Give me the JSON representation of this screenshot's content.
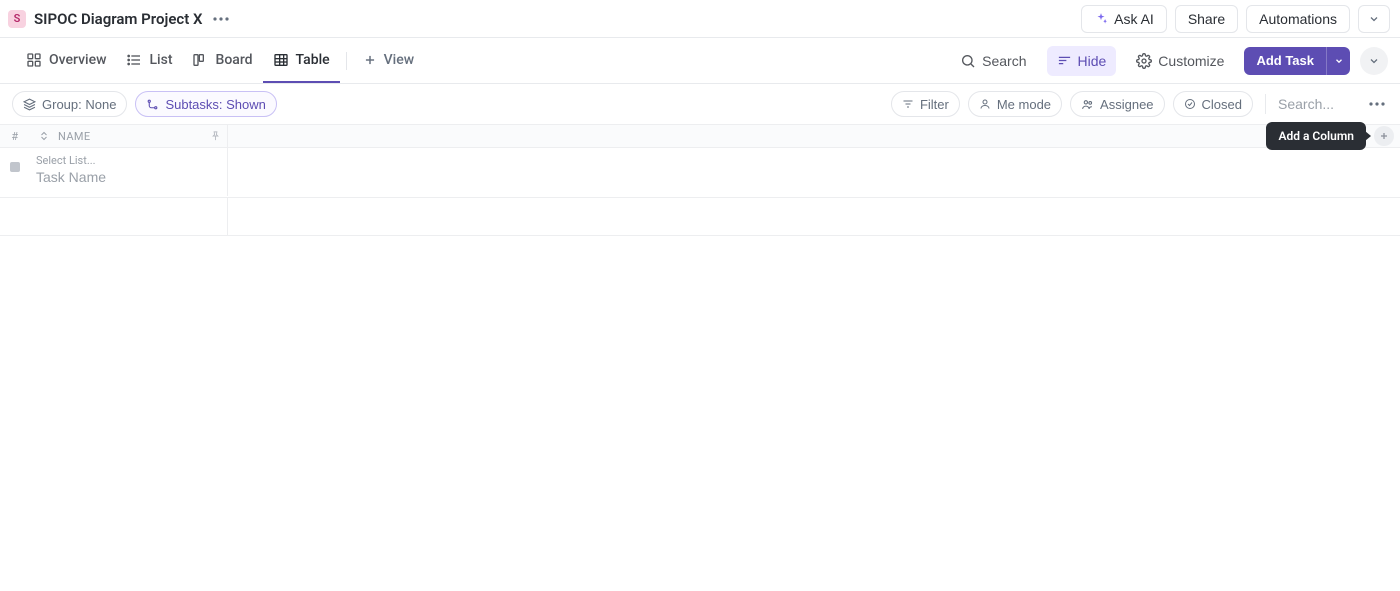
{
  "workspace": {
    "icon_letter": "S",
    "title": "SIPOC Diagram Project X"
  },
  "header_actions": {
    "ask_ai": "Ask AI",
    "share": "Share",
    "automations": "Automations"
  },
  "views": {
    "overview": "Overview",
    "list": "List",
    "board": "Board",
    "table": "Table",
    "add_view": "View"
  },
  "view_actions": {
    "search": "Search",
    "hide": "Hide",
    "customize": "Customize",
    "add_task": "Add Task"
  },
  "filters": {
    "group": "Group: None",
    "subtasks": "Subtasks: Shown",
    "filter": "Filter",
    "me_mode": "Me mode",
    "assignee": "Assignee",
    "closed": "Closed",
    "search_placeholder": "Search..."
  },
  "columns": {
    "index": "#",
    "name": "NAME",
    "add_tooltip": "Add a Column"
  },
  "new_task": {
    "select_list": "Select List...",
    "placeholder": "Task Name"
  }
}
